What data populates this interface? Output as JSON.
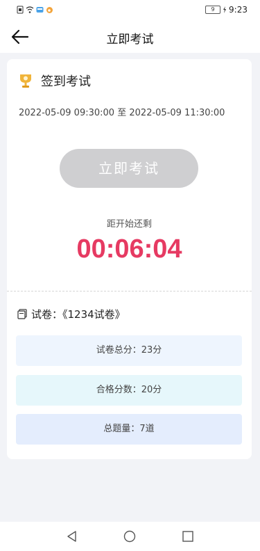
{
  "status_bar": {
    "time": "9:23",
    "battery": "9"
  },
  "header": {
    "title": "立即考试"
  },
  "exam": {
    "name": "签到考试",
    "start_time": "2022-05-09 09:30:00",
    "range_separator": "至",
    "end_time": "2022-05-09 11:30:00",
    "start_button": "立即考试",
    "remain_label": "距开始还剩",
    "countdown": "00:06:04"
  },
  "paper": {
    "label": "试卷：《1234试卷》"
  },
  "info": {
    "total_score": "试卷总分：23分",
    "pass_score": "合格分数：20分",
    "question_count": "总题量：7道"
  },
  "colors": {
    "countdown": "#e63a62",
    "button_disabled": "#cfcfd1",
    "trophy": "#f0b43a"
  }
}
